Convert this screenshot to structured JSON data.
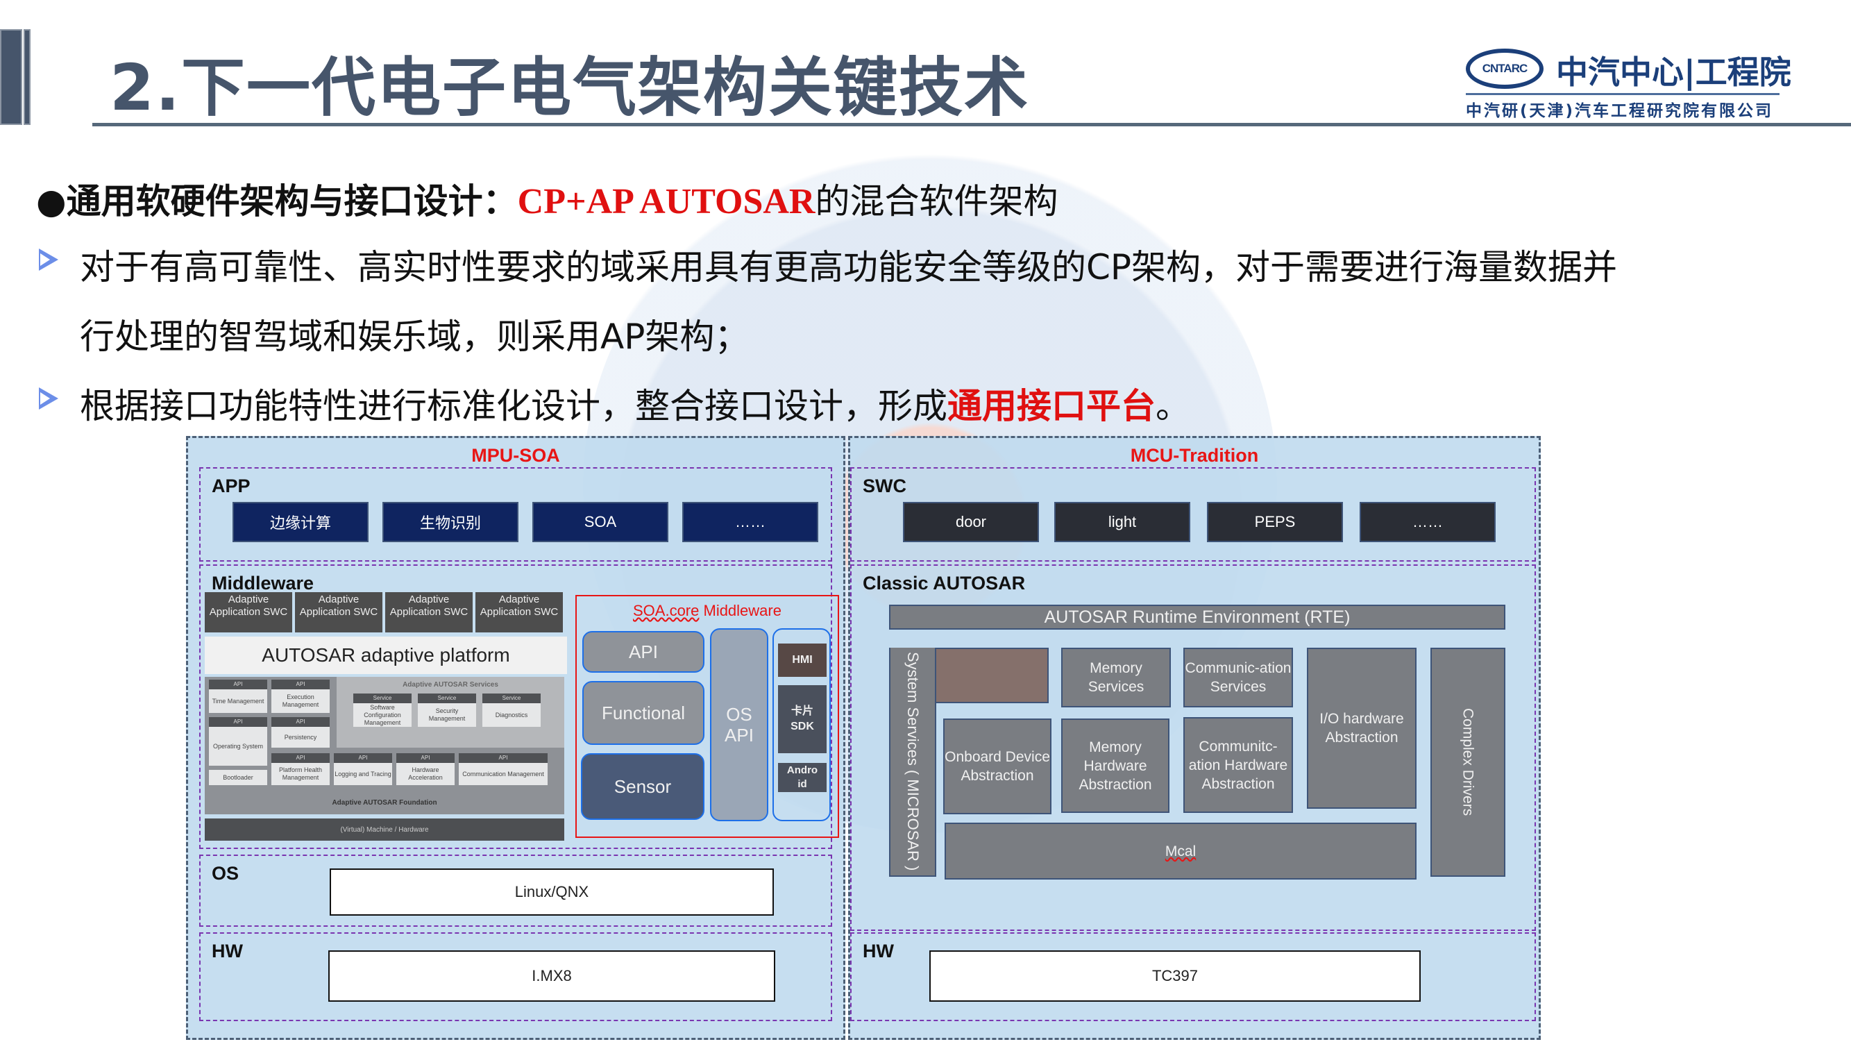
{
  "header": {
    "title": "2.下一代电子电气架构关键技术",
    "logo_abbr": "CNTARC",
    "logo_name": "中汽中心|工程院",
    "logo_subtitle": "中汽研(天津)汽车工程研究院有限公司"
  },
  "body": {
    "heading_bold": "●通用软硬件架构与接口设计：",
    "heading_red": "CP+AP  AUTOSAR",
    "heading_rest": "的混合软件架构",
    "bullet1_line1": "对于有高可靠性、高实时性要求的域采用具有更高功能安全等级的CP架构，对于需要进行海量数据并",
    "bullet1_line2": "行处理的智驾域和娱乐域，则采用AP架构；",
    "bullet2_text": "根据接口功能特性进行标准化设计，整合接口设计，形成",
    "bullet2_red": "通用接口平台",
    "bullet2_end": "。"
  },
  "diagram": {
    "left": {
      "title": "MPU-SOA",
      "app": {
        "label": "APP",
        "items": [
          "边缘计算",
          "生物识别",
          "SOA",
          "……"
        ]
      },
      "middleware": {
        "label": "Middleware",
        "swcs": [
          "Adaptive Application SWC",
          "Adaptive Application SWC",
          "Adaptive Application SWC",
          "Adaptive Application SWC"
        ],
        "platform_title": "AUTOSAR adaptive platform",
        "api_label": "API",
        "service_label": "Service",
        "services_title": "Adaptive AUTOSAR Services",
        "modules": {
          "time": "Time Management",
          "execution": "Execution Management",
          "os": "Operating System",
          "persistency": "Persistency",
          "bootloader": "Bootloader",
          "phm": "Platform Health Management",
          "logging": "Logging and Tracing",
          "hwaccel": "Hardware Acceleration",
          "comm": "Communication Management",
          "swconfig": "Software Configuration Management",
          "security": "Security Management",
          "diag": "Diagnostics"
        },
        "foundation": "Adaptive AUTOSAR Foundation",
        "vm": "(Virtual) Machine / Hardware",
        "soa_core": {
          "title_underlined": "SOA.core",
          "title_rest": " Middleware",
          "api": "API",
          "functional": "Functional",
          "sensor": "Sensor",
          "os_api": "OS API",
          "hmi": "HMI",
          "card_sdk": "卡片SDK",
          "android": "Android"
        }
      },
      "os": {
        "label": "OS",
        "value": "Linux/QNX"
      },
      "hw": {
        "label": "HW",
        "value": "I.MX8"
      }
    },
    "right": {
      "title": "MCU-Tradition",
      "swc": {
        "label": "SWC",
        "items": [
          "door",
          "light",
          "PEPS",
          "……"
        ]
      },
      "classic": {
        "label": "Classic AUTOSAR",
        "rte": "AUTOSAR Runtime Environment   (RTE)",
        "system_services": "System Services ( MICROSAR )",
        "memory_services": "Memory Services",
        "comm_services": "Communic-ation Services",
        "io_hw": "I/O hardware Abstraction",
        "complex_drivers": "Complex Drivers",
        "onboard": "Onboard Device Abstraction",
        "memory_hw": "Memory Hardware Abstraction",
        "comm_hw": "Communitc-ation Hardware Abstraction",
        "mcal": "Mcal"
      },
      "hw": {
        "label": "HW",
        "value": "TC397"
      }
    }
  }
}
